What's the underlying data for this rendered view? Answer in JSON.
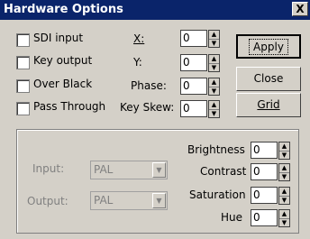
{
  "window": {
    "title": "Hardware Options",
    "close_symbol": "X"
  },
  "checkboxes": [
    {
      "label": "SDI input",
      "checked": false
    },
    {
      "label": "Key output",
      "checked": false
    },
    {
      "label": "Over Black",
      "checked": false
    },
    {
      "label": "Pass Through",
      "checked": false
    }
  ],
  "fields": {
    "x": {
      "label": "X:",
      "value": "0"
    },
    "y": {
      "label": "Y:",
      "value": "0"
    },
    "phase": {
      "label": "Phase:",
      "value": "0"
    },
    "key_skew": {
      "label": "Key Skew:",
      "value": "0"
    }
  },
  "buttons": {
    "apply": "Apply",
    "close": "Close",
    "grid": "Grid"
  },
  "group": {
    "input_label": "Input:",
    "input_value": "PAL",
    "output_label": "Output:",
    "output_value": "PAL",
    "brightness": {
      "label": "Brightness",
      "value": "0"
    },
    "contrast": {
      "label": "Contrast",
      "value": "0"
    },
    "saturation": {
      "label": "Saturation",
      "value": "0"
    },
    "hue": {
      "label": "Hue",
      "value": "0"
    }
  },
  "icons": {
    "spin_up": "▲",
    "spin_down": "▼",
    "combo_arrow": "▼"
  }
}
